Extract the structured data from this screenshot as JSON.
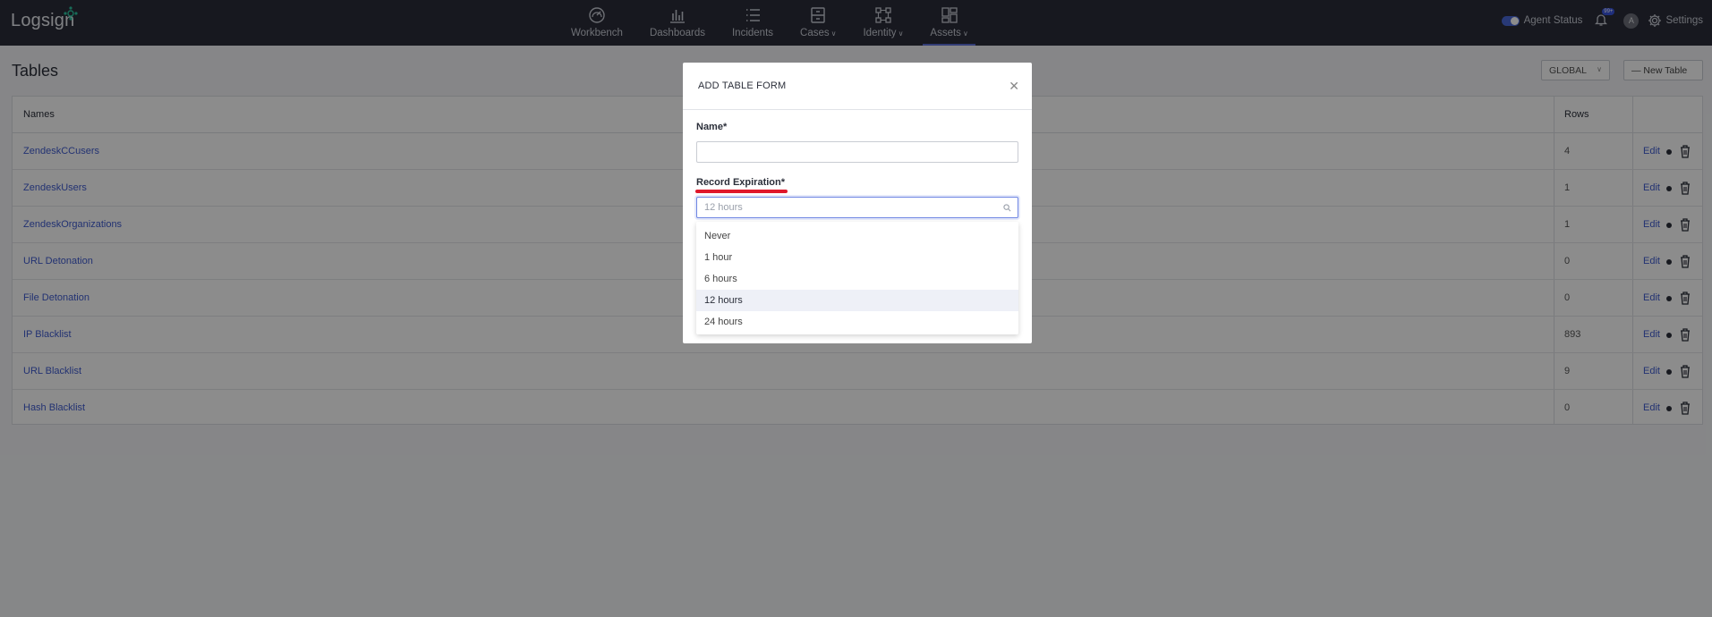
{
  "app": {
    "logo": "Logsign"
  },
  "nav": [
    {
      "label": "Workbench",
      "icon": "gauge-icon"
    },
    {
      "label": "Dashboards",
      "icon": "bar-chart-icon"
    },
    {
      "label": "Incidents",
      "icon": "list-icon"
    },
    {
      "label": "Cases",
      "icon": "cases-icon",
      "has_dropdown": true
    },
    {
      "label": "Identity",
      "icon": "identity-icon",
      "has_dropdown": true
    },
    {
      "label": "Assets",
      "icon": "assets-icon",
      "has_dropdown": true
    }
  ],
  "topright": {
    "agent_status": "Agent Status",
    "notif_badge": "99+",
    "avatar": "A",
    "settings": "Settings"
  },
  "page": {
    "title": "Tables",
    "scope_select": "GLOBAL",
    "new_table": "New Table",
    "columns": {
      "names": "Names",
      "rows": "Rows"
    },
    "edit_label": "Edit",
    "rows": [
      {
        "name": "ZendeskCCusers",
        "rows": "4"
      },
      {
        "name": "ZendeskUsers",
        "rows": "1"
      },
      {
        "name": "ZendeskOrganizations",
        "rows": "1"
      },
      {
        "name": "URL Detonation",
        "rows": "0"
      },
      {
        "name": "File Detonation",
        "rows": "0"
      },
      {
        "name": "IP Blacklist",
        "rows": "893"
      },
      {
        "name": "URL Blacklist",
        "rows": "9"
      },
      {
        "name": "Hash Blacklist",
        "rows": "0"
      }
    ]
  },
  "modal": {
    "title": "ADD TABLE FORM",
    "name_label": "Name*",
    "name_value": "",
    "expiration_label": "Record Expiration*",
    "expiration_placeholder": "12 hours",
    "options": [
      "Never",
      "1 hour",
      "6 hours",
      "12 hours",
      "24 hours"
    ],
    "selected_option": "12 hours"
  },
  "colors": {
    "accent": "#3f5bd0",
    "nav_bg": "#2a2d3a",
    "highlight": "#e0182b"
  }
}
